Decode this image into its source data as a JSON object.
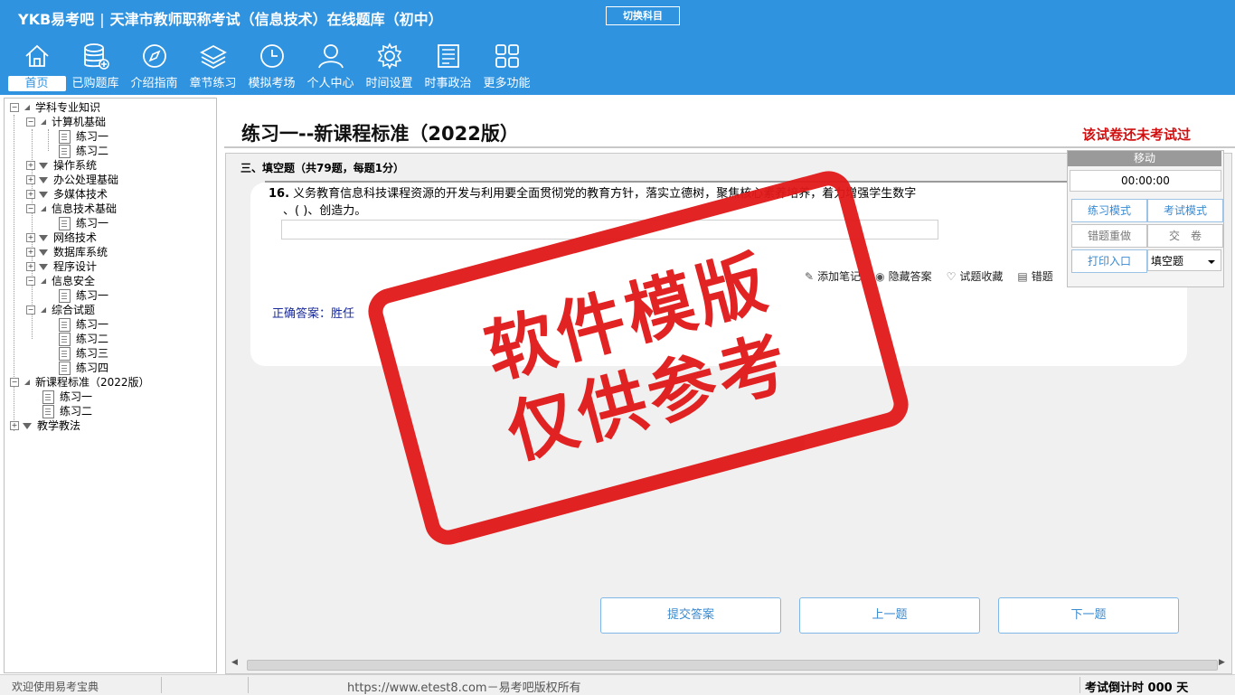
{
  "header": {
    "brand": "YKB易考吧",
    "title": "天津市教师职称考试（信息技术）在线题库（初中）",
    "switch_subject": "切换科目"
  },
  "nav": [
    {
      "label": "首页",
      "icon": "home-icon"
    },
    {
      "label": "已购题库",
      "icon": "database-icon"
    },
    {
      "label": "介绍指南",
      "icon": "compass-icon"
    },
    {
      "label": "章节练习",
      "icon": "layers-icon"
    },
    {
      "label": "模拟考场",
      "icon": "clock-icon"
    },
    {
      "label": "个人中心",
      "icon": "user-icon"
    },
    {
      "label": "时间设置",
      "icon": "gear-icon"
    },
    {
      "label": "时事政治",
      "icon": "news-icon"
    },
    {
      "label": "更多功能",
      "icon": "grid-icon"
    }
  ],
  "tree": {
    "root": "学科专业知识",
    "computer": "计算机基础",
    "c_ex1": "练习一",
    "c_ex2": "练习二",
    "os": "操作系统",
    "office": "办公处理基础",
    "multimedia": "多媒体技术",
    "it_basic": "信息技术基础",
    "it_ex1": "练习一",
    "network": "网络技术",
    "database": "数据库系统",
    "programming": "程序设计",
    "security": "信息安全",
    "sec_ex1": "练习一",
    "comprehensive": "综合试题",
    "comp_ex1": "练习一",
    "comp_ex2": "练习二",
    "comp_ex3": "练习三",
    "comp_ex4": "练习四",
    "new_std": "新课程标准（2022版）",
    "new_ex1": "练习一",
    "new_ex2": "练习二",
    "teaching": "教学教法"
  },
  "main": {
    "title": "练习一--新课程标准（2022版）",
    "exam_status": "该试卷还未考试过",
    "section": "三、填空题（共79题，每题1分）",
    "q_number": "16.",
    "q_text": "义务教育信息科技课程资源的开发与利用要全面贯彻党的教育方针，落实立德树",
    "q_text_tail": "，聚焦核心素养培养，着力增强学生数字",
    "q_cont": "、( )、创造力。",
    "correct": "正确答案：胜任",
    "tools": {
      "note": "添加笔记",
      "hide": "隐藏答案",
      "favorite": "试题收藏",
      "error": "错题"
    }
  },
  "side": {
    "move": "移动",
    "timer": "00:00:00",
    "practice_mode": "练习模式",
    "exam_mode": "考试模式",
    "redo": "错题重做",
    "submit": "交　卷",
    "print": "打印入口",
    "qtype": "填空题"
  },
  "stamp": {
    "line1": "软件模版",
    "line2": "仅供参考"
  },
  "bottom": {
    "submit": "提交答案",
    "prev": "上一题",
    "next": "下一题"
  },
  "status": {
    "welcome": "欢迎使用易考宝典",
    "url": "https://www.etest8.com－易考吧版权所有",
    "countdown": "考试倒计时 000 天"
  }
}
